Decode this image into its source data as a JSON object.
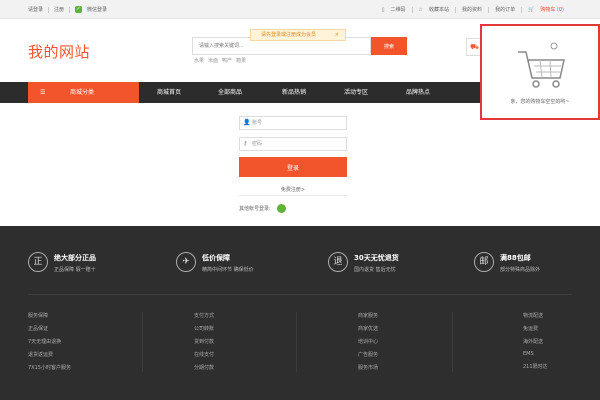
{
  "topbar": {
    "login": "请登录",
    "register": "注册",
    "wechat_login": "微信登录",
    "qrcode": "二维码",
    "favorite": "收藏本站",
    "profile": "我的资料",
    "orders": "我的订单",
    "cart": "购物车 (0)"
  },
  "logo": "我的网站",
  "search": {
    "placeholder": "请输入搜索关键词...",
    "button": "搜索",
    "hot": [
      "水果",
      "米面",
      "鸭产",
      "箱果"
    ]
  },
  "notice": "请先登录或注册成为会员",
  "nav": {
    "category": "商城分类",
    "items": [
      "商城首页",
      "全部商品",
      "新品热销",
      "活动专区",
      "品牌热点"
    ]
  },
  "cart_popup": {
    "empty_text": "亲，您的购物车空空的哟~"
  },
  "login": {
    "username_placeholder": "账号",
    "password_placeholder": "密码",
    "login_button": "登录",
    "register_link": "免费注册>",
    "other_login": "其他帐号登录:"
  },
  "footer": {
    "features": [
      {
        "icon": "正",
        "title": "绝大部分正品",
        "desc": "正品保障 假一赔十"
      },
      {
        "icon": "✈",
        "title": "低价保障",
        "desc": "精简中间环节 确保低价"
      },
      {
        "icon": "退",
        "title": "30天无忧退货",
        "desc": "国内退货 售后无忧"
      },
      {
        "icon": "邮",
        "title": "满88包邮",
        "desc": "部分特殊商品除外"
      }
    ],
    "columns": [
      [
        "服务保障",
        "正品保证",
        "7天无理由退换",
        "退货返运费",
        "7X15小时客户服务"
      ],
      [
        "支付方式",
        "公司转账",
        "货到付款",
        "在线支付",
        "分期付款"
      ],
      [
        "商家服务",
        "商家优选",
        "培训中心",
        "广告服务",
        "服务市场"
      ],
      [
        "物流配送",
        "免运费",
        "海外配送",
        "EMS",
        "211限时达"
      ]
    ]
  }
}
